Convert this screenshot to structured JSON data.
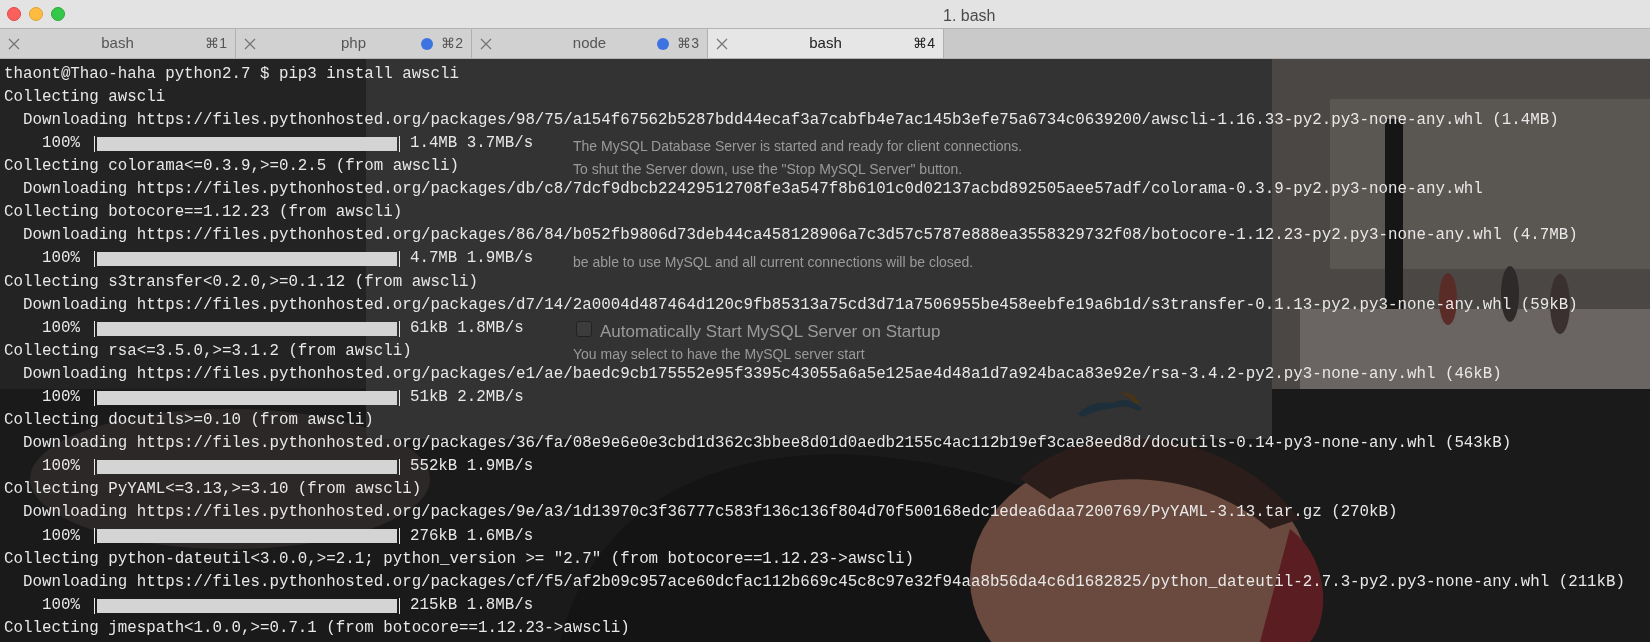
{
  "window": {
    "title": "1. bash"
  },
  "tabs": [
    {
      "label": "bash",
      "shortcut": "⌘1",
      "activity": false,
      "selected": false
    },
    {
      "label": "php",
      "shortcut": "⌘2",
      "activity": true,
      "selected": false
    },
    {
      "label": "node",
      "shortcut": "⌘3",
      "activity": true,
      "selected": false
    },
    {
      "label": "bash",
      "shortcut": "⌘4",
      "activity": false,
      "selected": true
    }
  ],
  "background_window": {
    "status_lines": [
      "The MySQL Database Server is started and ready for client connections.",
      "To shut the Server down, use the \"Stop MySQL Server\" button."
    ],
    "warning": "be able to use MySQL and all current connections will be closed.",
    "autostart": {
      "label": "Automatically Start MySQL Server on Startup",
      "checked": false
    },
    "autostart_note": "You may select to have the MySQL server start"
  },
  "terminal": {
    "lines": [
      {
        "kind": "text",
        "text": "thaont@Thao-haha python2.7 $ pip3 install awscli"
      },
      {
        "kind": "text",
        "text": "Collecting awscli"
      },
      {
        "kind": "text",
        "text": "  Downloading https://files.pythonhosted.org/packages/98/75/a154f67562b5287bdd44ecaf3a7cabfb4e7ac145b3efe75a6734c0639200/awscli-1.16.33-py2.py3-none-any.whl (1.4MB)"
      },
      {
        "kind": "progress",
        "percent": "100%",
        "level": 1,
        "stats": "1.4MB 3.7MB/s"
      },
      {
        "kind": "text",
        "text": "Collecting colorama<=0.3.9,>=0.2.5 (from awscli)"
      },
      {
        "kind": "text",
        "text": "  Downloading https://files.pythonhosted.org/packages/db/c8/7dcf9dbcb22429512708fe3a547f8b6101c0d02137acbd892505aee57adf/colorama-0.3.9-py2.py3-none-any.whl"
      },
      {
        "kind": "text",
        "text": "Collecting botocore==1.12.23 (from awscli)"
      },
      {
        "kind": "text",
        "text": "  Downloading https://files.pythonhosted.org/packages/86/84/b052fb9806d73deb44ca458128906a7c3d57c5787e888ea3558329732f08/botocore-1.12.23-py2.py3-none-any.whl (4.7MB)"
      },
      {
        "kind": "progress",
        "percent": "100%",
        "level": 1,
        "stats": "4.7MB 1.9MB/s"
      },
      {
        "kind": "text",
        "text": "Collecting s3transfer<0.2.0,>=0.1.12 (from awscli)"
      },
      {
        "kind": "text",
        "text": "  Downloading https://files.pythonhosted.org/packages/d7/14/2a0004d487464d120c9fb85313a75cd3d71a7506955be458eebfe19a6b1d/s3transfer-0.1.13-py2.py3-none-any.whl (59kB)"
      },
      {
        "kind": "progress",
        "percent": "100%",
        "level": 1,
        "stats": "61kB 1.8MB/s"
      },
      {
        "kind": "text",
        "text": "Collecting rsa<=3.5.0,>=3.1.2 (from awscli)"
      },
      {
        "kind": "text",
        "text": "  Downloading https://files.pythonhosted.org/packages/e1/ae/baedc9cb175552e95f3395c43055a6a5e125ae4d48a1d7a924baca83e92e/rsa-3.4.2-py2.py3-none-any.whl (46kB)"
      },
      {
        "kind": "progress",
        "percent": "100%",
        "level": 1,
        "stats": "51kB 2.2MB/s"
      },
      {
        "kind": "text",
        "text": "Collecting docutils>=0.10 (from awscli)"
      },
      {
        "kind": "text",
        "text": "  Downloading https://files.pythonhosted.org/packages/36/fa/08e9e6e0e3cbd1d362c3bbee8d01d0aedb2155c4ac112b19ef3cae8eed8d/docutils-0.14-py3-none-any.whl (543kB)"
      },
      {
        "kind": "progress",
        "percent": "100%",
        "level": 1,
        "stats": "552kB 1.9MB/s"
      },
      {
        "kind": "text",
        "text": "Collecting PyYAML<=3.13,>=3.10 (from awscli)"
      },
      {
        "kind": "text",
        "text": "  Downloading https://files.pythonhosted.org/packages/9e/a3/1d13970c3f36777c583f136c136f804d70f500168edc1edea6daa7200769/PyYAML-3.13.tar.gz (270kB)"
      },
      {
        "kind": "progress",
        "percent": "100%",
        "level": 1,
        "stats": "276kB 1.6MB/s"
      },
      {
        "kind": "text",
        "text": "Collecting python-dateutil<3.0.0,>=2.1; python_version >= \"2.7\" (from botocore==1.12.23->awscli)"
      },
      {
        "kind": "text",
        "text": "  Downloading https://files.pythonhosted.org/packages/cf/f5/af2b09c957ace60dcfac112b669c45c8c97e32f94aa8b56da4c6d1682825/python_dateutil-2.7.3-py2.py3-none-any.whl (211kB)"
      },
      {
        "kind": "progress",
        "percent": "100%",
        "level": 1,
        "stats": "215kB 1.8MB/s"
      },
      {
        "kind": "text",
        "text": "Collecting jmespath<1.0.0,>=0.7.1 (from botocore==1.12.23->awscli)"
      }
    ]
  }
}
